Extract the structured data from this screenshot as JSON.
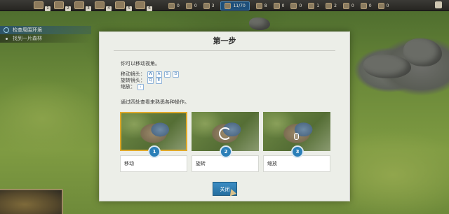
{
  "topbar": {
    "hotkeys": [
      "1",
      "2",
      "3",
      "4",
      "5",
      "6"
    ],
    "resources": [
      {
        "icon": "wood-icon",
        "value": "0"
      },
      {
        "icon": "stone-icon",
        "value": "0"
      },
      {
        "icon": "food-icon",
        "value": "3"
      },
      {
        "icon": "population-icon",
        "value": "11/70"
      },
      {
        "icon": "tool-icon",
        "value": "8"
      },
      {
        "icon": "iron-icon",
        "value": "0"
      },
      {
        "icon": "gold-icon",
        "value": "0"
      },
      {
        "icon": "cloth-icon",
        "value": "1"
      },
      {
        "icon": "meat-icon",
        "value": "2"
      },
      {
        "icon": "grain-icon",
        "value": "0"
      },
      {
        "icon": "brick-icon",
        "value": "0"
      },
      {
        "icon": "coin-icon",
        "value": "0"
      }
    ]
  },
  "quest": {
    "items": [
      {
        "label": "检查周围环境",
        "active": true
      },
      {
        "label": "找到一片森林",
        "active": false
      }
    ]
  },
  "dialog": {
    "title": "第一步",
    "intro": "你可以移动视角。",
    "keys": {
      "move_label": "移动镜头：",
      "move_keys": [
        "W",
        "A",
        "S",
        "D"
      ],
      "rotate_label": "旋转镜头：",
      "rotate_keys": [
        "Q",
        "E"
      ],
      "zoom_label": "缩放："
    },
    "hint": "通过四处查看来熟悉各种操作。",
    "cards": [
      {
        "num": "1",
        "label": "移动"
      },
      {
        "num": "2",
        "label": "旋转"
      },
      {
        "num": "3",
        "label": "缩放"
      }
    ],
    "close_label": "关闭"
  },
  "colors": {
    "accent": "#2b7fb8",
    "selected_border": "#e0a92a"
  }
}
